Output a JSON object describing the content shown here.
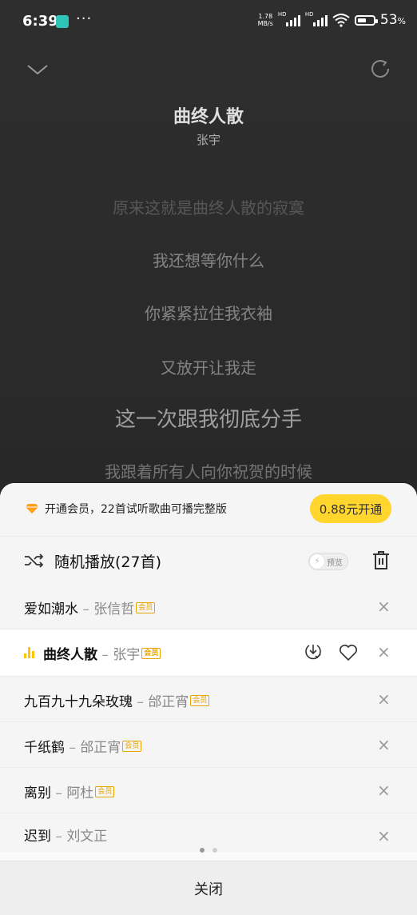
{
  "status_bar": {
    "time": "6:39",
    "dots": "···",
    "net_speed_value": "1.78",
    "net_speed_unit": "MB/s",
    "hd_label": "HD",
    "battery_percent": "53",
    "battery_pct_sign": "%",
    "battery_level": 0.53
  },
  "player": {
    "song_title": "曲终人散",
    "artist": "张宇",
    "lyrics": [
      "原来这就是曲终人散的寂寞",
      "我还想等你什么",
      "你紧紧拉住我衣袖",
      "又放开让我走",
      "这一次跟我彻底分手",
      "我跟着所有人向你祝贺的时候"
    ]
  },
  "vip": {
    "text": "开通会员，22首试听歌曲可播完整版",
    "button": "0.88元开通"
  },
  "playlist": {
    "mode_label": "随机播放(27首)",
    "preview_label": "预览",
    "vip_badge": "会员",
    "separator": " – ",
    "close_symbol": "×",
    "items": [
      {
        "title": "爱如潮水",
        "artist": "张信哲",
        "vip": true,
        "active": false
      },
      {
        "title": "曲终人散",
        "artist": "张宇",
        "vip": true,
        "active": true
      },
      {
        "title": "九百九十九朵玫瑰",
        "artist": "邰正宵",
        "vip": true,
        "active": false
      },
      {
        "title": "千纸鹤",
        "artist": "邰正宵",
        "vip": true,
        "active": false
      },
      {
        "title": "离别",
        "artist": "阿杜",
        "vip": true,
        "active": false
      },
      {
        "title": "迟到",
        "artist": "刘文正",
        "vip": false,
        "active": false
      }
    ],
    "close_button": "关闭"
  },
  "colors": {
    "accent_yellow": "#ffd52e",
    "playing_bar": "#ffc300",
    "vip_badge": "#e8a400"
  }
}
